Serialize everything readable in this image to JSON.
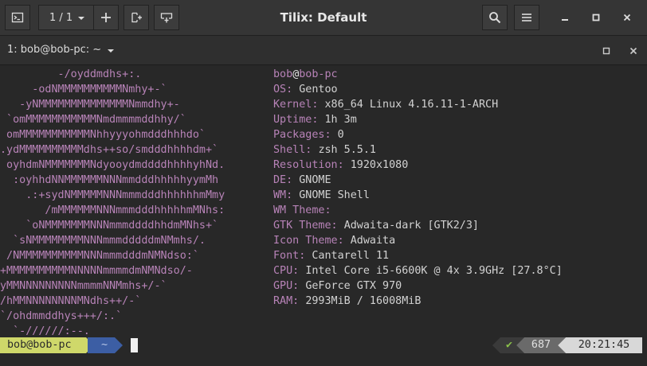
{
  "window": {
    "title": "Tilix: Default",
    "session_counter": "1 / 1",
    "tab_title": "1: bob@bob-pc: ~"
  },
  "icons": {
    "terminal": "terminal-icon",
    "dropdown": "chevron-down-icon",
    "add": "plus-icon",
    "split_right": "split-right-icon",
    "split_down": "split-down-icon",
    "search": "search-icon",
    "menu": "hamburger-icon",
    "minimize": "minimize-icon",
    "maximize": "maximize-icon",
    "close": "close-icon"
  },
  "colors": {
    "titlebar": "#353535",
    "terminal_bg": "#282828",
    "accent_purple": "#b883b8",
    "prompt_green": "#cfd86a",
    "prompt_blue": "#3c5ea4",
    "status_green": "#8bc34a"
  },
  "logo": [
    "         -/oyddmdhs+:.",
    "     -odNMMMMMMMMMMNmhy+-`",
    "   -yNMMMMMMMMMMMMMMNmmdhy+-",
    " `omMMMMMMMMMMMNmdmmmmddhhy/`",
    " omMMMMMMMMMMMNhhyyyohmdddhhhdo`",
    ".ydMMMMMMMMMMdhs++so/smdddhhhhdm+`",
    " oyhdmNMMMMMMMNdyooydmddddhhhhyhNd.",
    "  :oyhhdNNMMMMMMNNNmmdddhhhhhyymMh",
    "    .:+sydNMMMMMNNNmmmdddhhhhhhmMmy",
    "       /mMMMMMMNNNmmmdddhhhhhmMNhs:",
    "    `oNMMMMMMMNNNmmmddddhhdmMNhs+`",
    "  `sNMMMMMMMMNNNmmmdddddmNMmhs/.",
    " /NMMMMMMMMMMNNNmmmdddmNMNdso:`",
    "+MMMMMMMMMMNNNNNmmmmdmNMNdso/-",
    "yMMNNNNNNNNNmmmmNNMmhs+/-`",
    "/hMMNNNNNNNNMNdhs++/-`",
    "`/ohdmmddhys+++/:.`",
    "  `-//////:--."
  ],
  "info": {
    "user": "bob",
    "at": "@",
    "host": "bob-pc",
    "rows": [
      {
        "key": "OS:",
        "value": "Gentoo"
      },
      {
        "key": "Kernel:",
        "value": "x86_64 Linux 4.16.11-1-ARCH"
      },
      {
        "key": "Uptime:",
        "value": "1h 3m"
      },
      {
        "key": "Packages:",
        "value": "0"
      },
      {
        "key": "Shell:",
        "value": "zsh 5.5.1"
      },
      {
        "key": "Resolution:",
        "value": "1920x1080"
      },
      {
        "key": "DE:",
        "value": "GNOME"
      },
      {
        "key": "WM:",
        "value": "GNOME Shell"
      },
      {
        "key": "WM Theme:",
        "value": ""
      },
      {
        "key": "GTK Theme:",
        "value": "Adwaita-dark [GTK2/3]"
      },
      {
        "key": "Icon Theme:",
        "value": "Adwaita"
      },
      {
        "key": "Font:",
        "value": "Cantarell 11"
      },
      {
        "key": "CPU:",
        "value": "Intel Core i5-6600K @ 4x 3.9GHz [27.8°C]"
      },
      {
        "key": "GPU:",
        "value": "GeForce GTX 970"
      },
      {
        "key": "RAM:",
        "value": "2993MiB / 16008MiB"
      }
    ]
  },
  "prompt": {
    "user_host": "bob@bob-pc",
    "path": "~",
    "status_check": "✔",
    "history_number": "687",
    "time": "20:21:45"
  }
}
